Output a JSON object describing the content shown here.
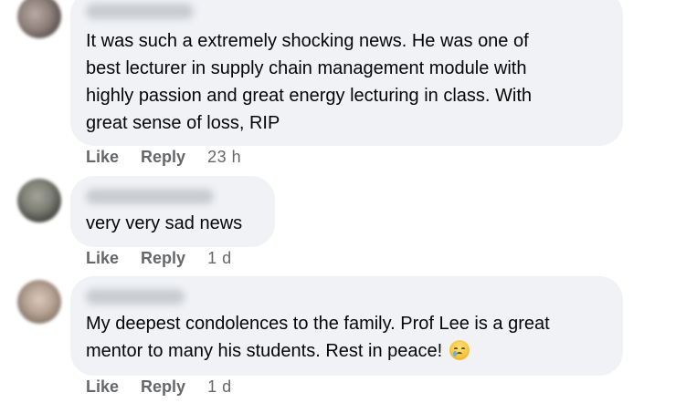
{
  "comments": [
    {
      "text": "It was such a extremely shocking news. He was one of\nbest lecturer in supply chain management module with\nhighly passion and great energy lecturing in class. With\ngreat sense of loss, RIP",
      "like_label": "Like",
      "reply_label": "Reply",
      "time": "23 h"
    },
    {
      "text": "very very sad news",
      "like_label": "Like",
      "reply_label": "Reply",
      "time": "1 d"
    },
    {
      "text": "My deepest condolences to the family. Prof Lee is a great\nmentor to many his students. Rest in peace!",
      "emoji": "crying-face",
      "like_label": "Like",
      "reply_label": "Reply",
      "time": "1 d"
    }
  ],
  "colors": {
    "bubble": "#f0f2f5",
    "text": "#050505",
    "meta": "#65676b"
  }
}
